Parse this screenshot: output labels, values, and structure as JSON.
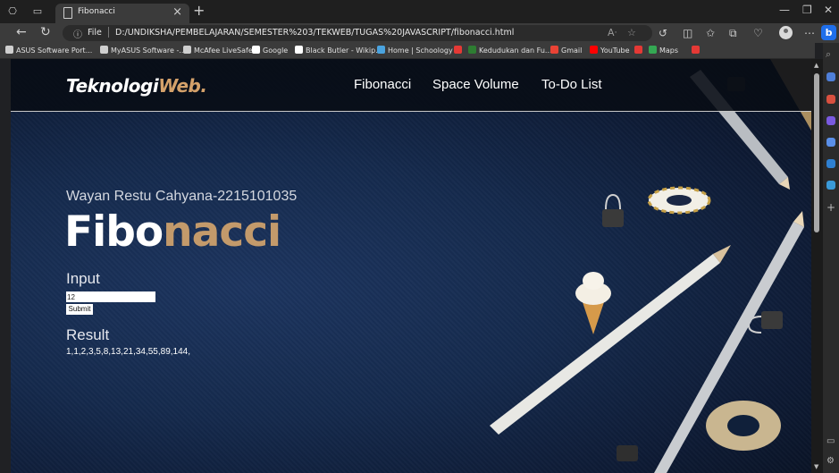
{
  "browser": {
    "tab_title": "Fibonacci",
    "tab_close": "×",
    "new_tab": "+",
    "omnibox_scheme_label": "File",
    "url": "D:/UNDIKSHA/PEMBELAJARAN/SEMESTER%203/TEKWEB/TUGAS%20JAVASCRIPT/fibonacci.html",
    "bookmarks": [
      {
        "label": "ASUS Software Port...",
        "color": "#cfcfcf"
      },
      {
        "label": "MyASUS Software -...",
        "color": "#cfcfcf"
      },
      {
        "label": "McAfee LiveSafe",
        "color": "#cfcfcf"
      },
      {
        "label": "Google",
        "color": "#ffffff"
      },
      {
        "label": "Black Butler - Wikip...",
        "color": "#ffffff"
      },
      {
        "label": "Home | Schoology",
        "color": "#4aa3df"
      },
      {
        "label": "",
        "color": "#e53935"
      },
      {
        "label": "Kedudukan dan Fu...",
        "color": "#2e7d32"
      },
      {
        "label": "Gmail",
        "color": "#ea4335"
      },
      {
        "label": "YouTube",
        "color": "#ff0000"
      },
      {
        "label": "",
        "color": "#e53935"
      },
      {
        "label": "Maps",
        "color": "#34a853"
      },
      {
        "label": "",
        "color": "#e53935"
      }
    ]
  },
  "site": {
    "brand_main": "Teknologi",
    "brand_accent": "Web.",
    "nav": [
      "Fibonacci",
      "Space Volume",
      "To-Do List"
    ],
    "author": "Wayan Restu Cahyana-2215101035",
    "hero_main": "Fibo",
    "hero_accent": "nacci",
    "input_label": "Input",
    "input_value": "12",
    "submit_label": "Submit",
    "result_label": "Result",
    "result_value": "1,1,2,3,5,8,13,21,34,55,89,144,",
    "accent_color": "#c39a6b"
  }
}
